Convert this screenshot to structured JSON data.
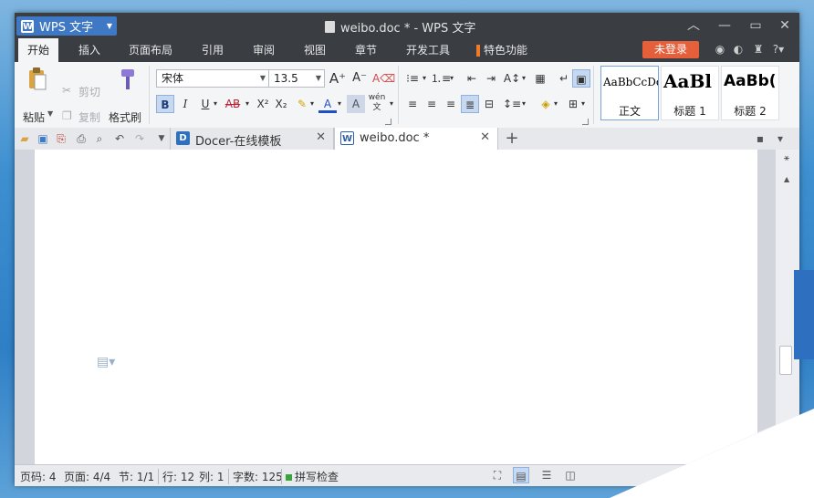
{
  "colors": {
    "accent": "#3f78c4",
    "login": "#e55f3b",
    "special": "#f07a2a"
  },
  "app": {
    "label": "WPS 文字",
    "icon": "wps-logo-icon"
  },
  "window": {
    "title": "weibo.doc * - WPS 文字",
    "controls": [
      "restore-up-icon",
      "minimize-icon",
      "maximize-icon",
      "close-icon"
    ]
  },
  "menu": {
    "tabs": [
      "开始",
      "插入",
      "页面布局",
      "引用",
      "审阅",
      "视图",
      "章节",
      "开发工具",
      "特色功能"
    ],
    "active": "开始",
    "login": "未登录"
  },
  "ribbon": {
    "paste": "粘贴",
    "cut": "剪切",
    "copy": "复制",
    "format_painter": "格式刷",
    "font_name": "宋体",
    "font_size": "13.5",
    "phonetic": "wén",
    "styles": [
      {
        "preview": "AaBbCcDd",
        "name": "正文"
      },
      {
        "preview": "AaBl",
        "name": "标题 1"
      },
      {
        "preview": "AaBb(",
        "name": "标题 2"
      }
    ]
  },
  "doctabs": [
    {
      "label": "Docer-在线模板",
      "icon": "D"
    },
    {
      "label": "weibo.doc *",
      "icon": "W"
    }
  ],
  "status": {
    "page_code": "页码: 4",
    "pages": "页面: 4/4",
    "section": "节: 1/1",
    "row": "行: 12",
    "col": "列: 1",
    "words": "字数: 125",
    "spell": "拼写检查"
  }
}
